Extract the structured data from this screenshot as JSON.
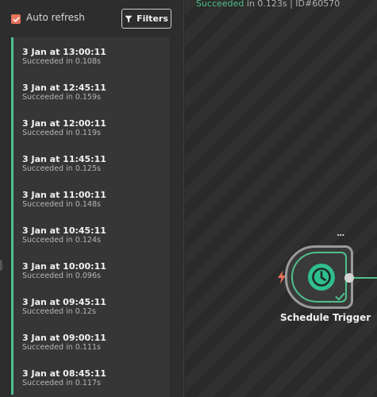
{
  "toolbar": {
    "auto_refresh_label": "Auto refresh",
    "auto_refresh_checked": true,
    "filters_label": "Filters"
  },
  "executions": [
    {
      "time": "3 Jan at 13:00:11",
      "status": "Succeeded in 0.108s"
    },
    {
      "time": "3 Jan at 12:45:11",
      "status": "Succeeded in 0.159s"
    },
    {
      "time": "3 Jan at 12:00:11",
      "status": "Succeeded in 0.119s"
    },
    {
      "time": "3 Jan at 11:45:11",
      "status": "Succeeded in 0.125s"
    },
    {
      "time": "3 Jan at 11:00:11",
      "status": "Succeeded in 0.148s"
    },
    {
      "time": "3 Jan at 10:45:11",
      "status": "Succeeded in 0.124s"
    },
    {
      "time": "3 Jan at 10:00:11",
      "status": "Succeeded in 0.096s"
    },
    {
      "time": "3 Jan at 09:45:11",
      "status": "Succeeded in 0.12s"
    },
    {
      "time": "3 Jan at 09:00:11",
      "status": "Succeeded in 0.111s"
    },
    {
      "time": "3 Jan at 08:45:11",
      "status": "Succeeded in 0.117s"
    }
  ],
  "canvas": {
    "status_word": "Succeeded",
    "status_rest": " in 0.123s | ID#60570",
    "node": {
      "label": "Schedule Trigger",
      "icon": "clock-icon",
      "menu": "..."
    }
  },
  "colors": {
    "success": "#4fc08d",
    "accent": "#e8715b",
    "node_icon": "#2fbf8e"
  }
}
